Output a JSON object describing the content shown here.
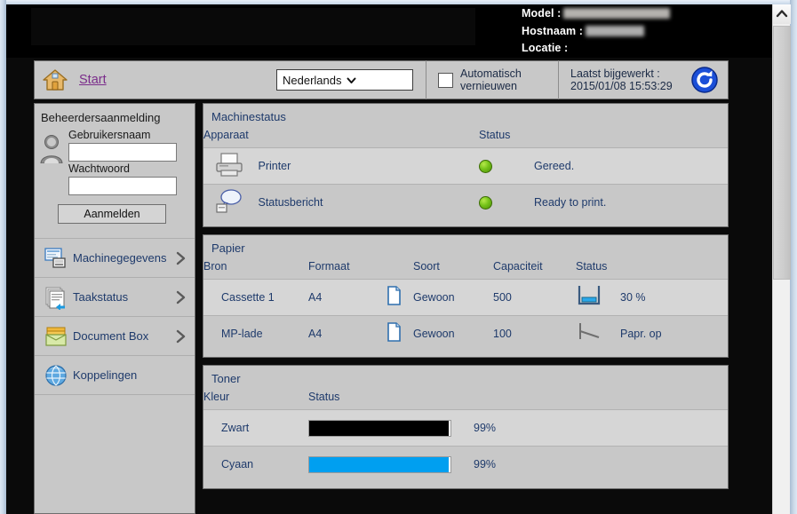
{
  "banner": {
    "model_label": "Model :",
    "hostname_label": "Hostnaam :",
    "location_label": "Locatie :",
    "model_value": "",
    "hostname_value": "",
    "location_value": ""
  },
  "toolbar": {
    "home_icon": "home-icon",
    "start_label": "Start",
    "language_value": "Nederlands",
    "auto_refresh_label": "Automatisch\nvernieuwen",
    "auto_refresh_line1": "Automatisch",
    "auto_refresh_line2": "vernieuwen",
    "auto_refresh_checked": false,
    "last_updated_label": "Laatst bijgewerkt :",
    "last_updated_value": "2015/01/08 15:53:29",
    "refresh_icon": "refresh-icon"
  },
  "sidebar": {
    "login_title": "Beheerdersaanmelding",
    "user_icon": "user-avatar-icon",
    "username_label": "Gebruikersnaam",
    "username_value": "",
    "password_label": "Wachtwoord",
    "password_value": "",
    "login_button": "Aanmelden",
    "nav": [
      {
        "label": "Machinegegevens",
        "icon": "machine-info-icon",
        "chevron": true
      },
      {
        "label": "Taakstatus",
        "icon": "job-status-icon",
        "chevron": true
      },
      {
        "label": "Document Box",
        "icon": "document-box-icon",
        "chevron": true
      },
      {
        "label": "Koppelingen",
        "icon": "globe-links-icon",
        "chevron": false
      }
    ]
  },
  "machine_status": {
    "title": "Machinestatus",
    "columns": {
      "device": "Apparaat",
      "status": "Status"
    },
    "rows": [
      {
        "icon": "printer-icon",
        "device": "Printer",
        "led": "#76c31a",
        "status": "Gereed."
      },
      {
        "icon": "status-message-icon",
        "device": "Statusbericht",
        "led": "#76c31a",
        "status": "Ready to print."
      }
    ]
  },
  "paper": {
    "title": "Papier",
    "columns": {
      "source": "Bron",
      "size": "Formaat",
      "type": "Soort",
      "capacity": "Capaciteit",
      "status": "Status"
    },
    "rows": [
      {
        "source": "Cassette 1",
        "size": "A4",
        "sheet_icon": "paper-sheet-icon",
        "type": "Gewoon",
        "capacity": "500",
        "gauge_icon": "tray-level-icon",
        "gauge_level": 30,
        "status": "30 %"
      },
      {
        "source": "MP-lade",
        "size": "A4",
        "sheet_icon": "paper-sheet-icon",
        "type": "Gewoon",
        "capacity": "100",
        "gauge_icon": "tray-empty-icon",
        "gauge_level": 0,
        "status": "Papr. op"
      }
    ]
  },
  "toner": {
    "title": "Toner",
    "columns": {
      "color": "Kleur",
      "status": "Status"
    },
    "rows": [
      {
        "color": "Zwart",
        "bar_color": "#000000",
        "percent": 99,
        "percent_label": "99%"
      },
      {
        "color": "Cyaan",
        "bar_color": "#009ff0",
        "percent": 99,
        "percent_label": "99%"
      }
    ]
  },
  "scrollbar": {
    "up_arrow_icon": "chevron-up-icon"
  }
}
